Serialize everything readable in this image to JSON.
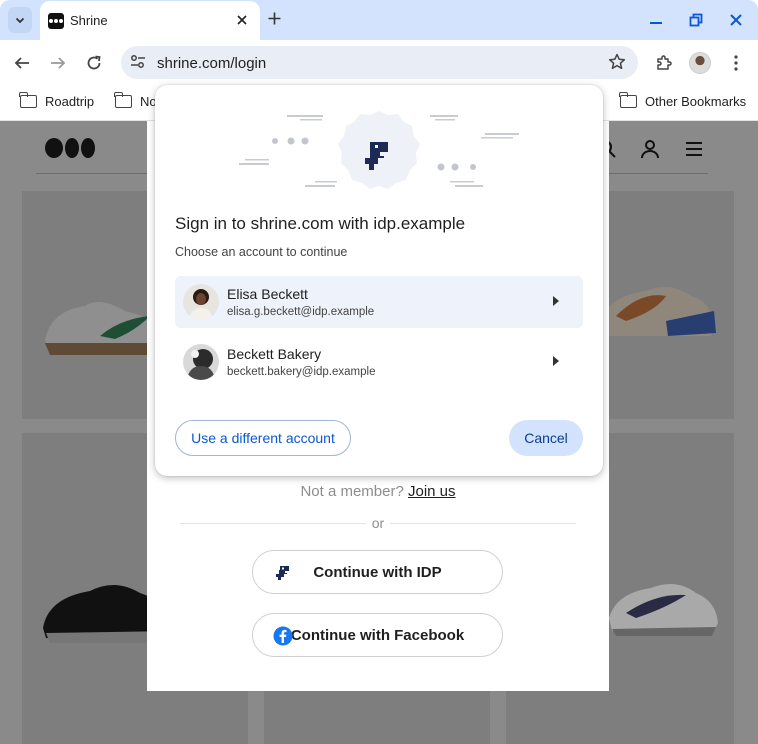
{
  "browser": {
    "tab_title": "Shrine",
    "url": "shrine.com/login",
    "bookmarks": [
      "Roadtrip",
      "No",
      "Other Bookmarks"
    ]
  },
  "page": {
    "not_member_text": "Not a member?",
    "join_link": "Join us",
    "or_text": "or",
    "continue_idp": "Continue with IDP",
    "continue_facebook": "Continue with Facebook"
  },
  "dialog": {
    "title": "Sign in to shrine.com with idp.example",
    "subtitle": "Choose an account to continue",
    "accounts": [
      {
        "name": "Elisa Beckett",
        "email": "elisa.g.beckett@idp.example",
        "selected": true
      },
      {
        "name": "Beckett Bakery",
        "email": "beckett.bakery@idp.example",
        "selected": false
      }
    ],
    "use_different_label": "Use a different account",
    "cancel_label": "Cancel"
  },
  "icons": {
    "tab_search": "chevron-down-icon",
    "back": "arrow-left-icon",
    "forward": "arrow-right-icon",
    "reload": "reload-icon",
    "site_info": "tune-icon",
    "bookmark": "star-icon",
    "extensions": "puzzle-icon",
    "menu": "kebab-menu-icon"
  },
  "colors": {
    "accent": "#0b57d0",
    "tab_strip": "#d3e3fd",
    "selected_account": "#eef2fa",
    "facebook": "#1877f2",
    "idp_brand": "#1c2a55"
  }
}
